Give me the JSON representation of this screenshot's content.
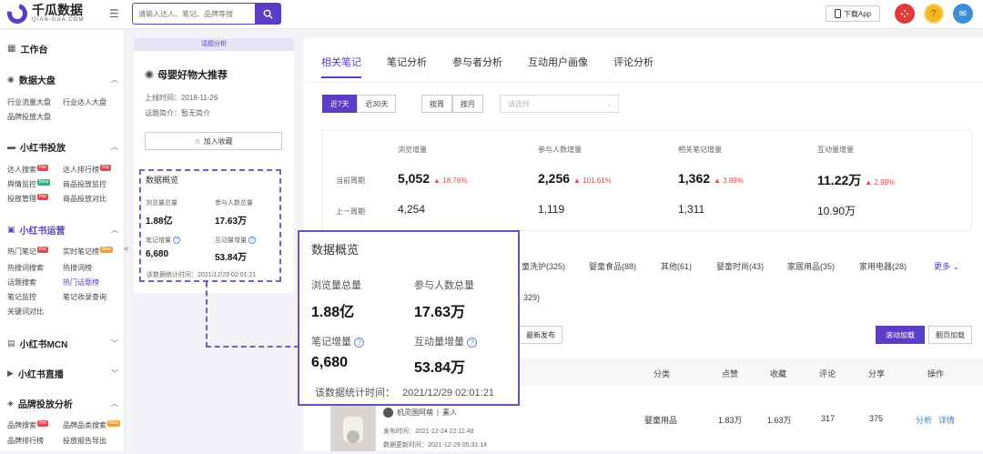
{
  "brand": {
    "name_cn": "千瓜数据",
    "name_en": "QIAN-GUA.COM"
  },
  "search": {
    "placeholder": "请输入达人、笔记、品牌等搜"
  },
  "header": {
    "download": "下载App"
  },
  "sidebar": {
    "workbench": "工作台",
    "sections": [
      {
        "title": "数据大盘",
        "items": [
          "行业流量大盘",
          "行业达人大盘",
          "品牌投放大盘"
        ]
      },
      {
        "title": "小红书投放",
        "items": [
          "达人搜索",
          "达人排行榜",
          "舆情监控",
          "商品投放监控",
          "投放管理",
          "商品投放对比"
        ]
      },
      {
        "title": "小红书运营",
        "items": [
          "热门笔记",
          "实时笔记榜",
          "热搜词搜索",
          "热搜词榜",
          "话题搜索",
          "热门话题榜",
          "笔记监控",
          "笔记收录查询",
          "关键词对比"
        ]
      },
      {
        "title": "小红书MCN"
      },
      {
        "title": "小红书直播"
      },
      {
        "title": "品牌投放分析",
        "items": [
          "品牌搜索",
          "品牌品类搜索",
          "品牌排行榜",
          "投放报告导出"
        ]
      }
    ],
    "tags": {
      "hot": "Hot",
      "beta": "Beta",
      "new": "New"
    }
  },
  "topic_card": {
    "tag": "话题分析",
    "title": "母婴好物大推荐",
    "online_time": "上线时间：2018-11-26",
    "intro": "话题简介：暂无简介",
    "fav": "加入收藏",
    "overview_title": "数据概览",
    "views_label": "浏览量总量",
    "views": "1.88亿",
    "participants_label": "参与人数总量",
    "participants": "17.63万",
    "notes_label": "笔记增量",
    "notes": "6,680",
    "interact_label": "互动量增量",
    "interact": "53.84万",
    "stat_time": "该数据统计时间：2021/12/29 02:01:21"
  },
  "popup": {
    "title": "数据概览",
    "views_label": "浏览量总量",
    "views": "1.88亿",
    "participants_label": "参与人数总量",
    "participants": "17.63万",
    "notes_label": "笔记增量",
    "notes": "6,680",
    "interact_label": "互动量增量",
    "interact": "53.84万",
    "stat_label": "该数据统计时间：",
    "stat_time": "2021/12/29 02:01:21"
  },
  "main": {
    "tabs": [
      "相关笔记",
      "笔记分析",
      "参与者分析",
      "互动用户画像",
      "评论分析"
    ],
    "range": [
      "近7天",
      "近30天"
    ],
    "period": [
      "按周",
      "按月"
    ],
    "select_placeholder": "请选择",
    "stats": {
      "headers": [
        "浏览增量",
        "参与人数增量",
        "相关笔记增量",
        "互动量增量"
      ],
      "current_label": "当前周期",
      "previous_label": "上一周期",
      "current": [
        {
          "value": "5,052",
          "pct": "18.76%"
        },
        {
          "value": "2,256",
          "pct": "101.61%"
        },
        {
          "value": "1,362",
          "pct": "3.89%"
        },
        {
          "value": "11.22万",
          "pct": "2.99%"
        }
      ],
      "previous": [
        "4,254",
        "1,119",
        "1,311",
        "10.90万"
      ]
    },
    "categories": [
      "童洗护(325)",
      "婴童食品(88)",
      "其他(61)",
      "婴童时尚(43)",
      "家居用品(35)",
      "家用电器(28)"
    ],
    "more": "更多",
    "count_text": "329)",
    "sort_newest": "最新发布",
    "scroll_load": "滚动加载",
    "page_load": "翻页加载",
    "table_headers": [
      "分类",
      "点赞",
      "收藏",
      "评论",
      "分享",
      "操作"
    ],
    "row": {
      "author": "机灵国阿萌",
      "level": "素人",
      "publish": "发布时间：2021-12-24 22:11:48",
      "update": "数据更新时间：2021-12-29 05:31:14",
      "category": "婴童用品",
      "likes": "1.83万",
      "favs": "1.63万",
      "comments": "317",
      "shares": "375",
      "action1": "分析",
      "action2": "详情"
    }
  },
  "colors": {
    "brand": "#5b3cc4",
    "up": "#e24a4a",
    "link": "#3b82d6"
  }
}
